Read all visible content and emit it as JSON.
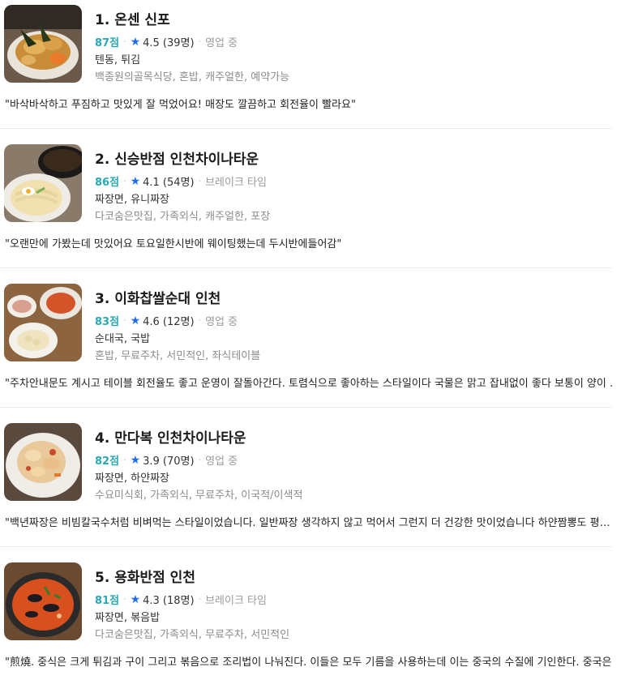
{
  "restaurants": [
    {
      "title": "1. 온센 신포",
      "score": "87점",
      "rating": "4.5 (39명)",
      "status": "영업 중",
      "categories": "텐동, 튀김",
      "tags": "백종원의골목식당, 혼밥, 캐주얼한, 예약가능",
      "review": "\"바삭바삭하고 푸짐하고 맛있게 잘 먹었어요! 매장도 깔끔하고 회전율이 빨라요\"",
      "thumb_icon": "tendon-photo-icon"
    },
    {
      "title": "2. 신승반점 인천차이나타운",
      "score": "86점",
      "rating": "4.1 (54명)",
      "status": "브레이크 타임",
      "categories": "짜장면, 유니짜장",
      "tags": "다코숨은맛집, 가족외식, 캐주얼한, 포장",
      "review": "\"오랜만에 가봤는데 맛있어요 토요일한시반에 웨이팅했는데 두시반에들어감\"",
      "thumb_icon": "jjajang-photo-icon"
    },
    {
      "title": "3. 이화찹쌀순대 인천",
      "score": "83점",
      "rating": "4.6 (12명)",
      "status": "영업 중",
      "categories": "순대국, 국밥",
      "tags": "혼밥, 무료주차, 서민적인, 좌식테이블",
      "review": "\"주차안내문도 계시고 테이블 회전율도 좋고 운영이 잘돌아간다. 토렴식으로 좋아하는 스타일이다 국물은 맑고 잡내없이 좋다 보통이 양이 … \"",
      "thumb_icon": "sundae-side-dishes-photo-icon"
    },
    {
      "title": "4. 만다복 인천차이나타운",
      "score": "82점",
      "rating": "3.9 (70명)",
      "status": "영업 중",
      "categories": "짜장면, 하얀짜장",
      "tags": "수요미식회, 가족외식, 무료주차, 이국적/이색적",
      "review": "\"백년짜장은 비빔칼국수처럼 비벼먹는 스타일이었습니다. 일반짜장 생각하지 않고 먹어서 그런지 더 건강한 맛이었습니다 하얀짬뽕도 평…   \"",
      "thumb_icon": "white-jjajang-photo-icon"
    },
    {
      "title": "5. 용화반점 인천",
      "score": "81점",
      "rating": "4.3 (18명)",
      "status": "브레이크 타임",
      "categories": "짜장면, 볶음밥",
      "tags": "다코숨은맛집, 가족외식, 무료주차, 서민적인",
      "review": "\"煎燒. 중식은 크게 튀김과 구이 그리고 볶음으로 조리법이 나눠진다. 이들은 모두 기름을 사용하는데 이는 중국의 수질에 기인한다. 중국은… \"",
      "thumb_icon": "jjamppong-photo-icon"
    }
  ],
  "colors": {
    "score": "#2aa9b5",
    "star": "#1e6fe8",
    "muted": "#9a9a9a"
  }
}
